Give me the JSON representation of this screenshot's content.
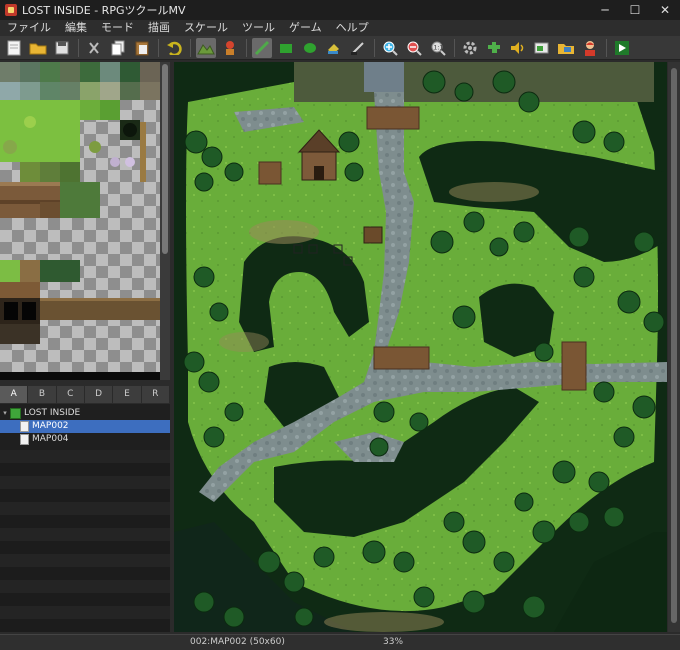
{
  "window": {
    "title": "LOST INSIDE - RPGツクールMV",
    "minimize": "─",
    "maximize": "☐",
    "close": "✕"
  },
  "menu": [
    "ファイル",
    "編集",
    "モード",
    "描画",
    "スケール",
    "ツール",
    "ゲーム",
    "ヘルプ"
  ],
  "toolbar": [
    "new-project",
    "open-project",
    "save-project",
    "cut",
    "copy",
    "paste",
    "undo",
    "map-mode",
    "event-mode",
    "pencil",
    "rectangle",
    "ellipse",
    "fill",
    "shadow-pen",
    "zoom-in",
    "zoom-out",
    "actual-size",
    "database",
    "plugin-manager",
    "sound-test",
    "event-searcher",
    "resource-manager",
    "character-generator",
    "playtest"
  ],
  "tileset_tabs": [
    "A",
    "B",
    "C",
    "D",
    "E",
    "R"
  ],
  "map_tree": {
    "root": "LOST INSIDE",
    "items": [
      "MAP002",
      "MAP004"
    ],
    "selected": "MAP002"
  },
  "status": {
    "map": "002:MAP002 (50x60)",
    "zoom": "33%"
  },
  "colors": {
    "accent": "#3d6ebf",
    "grass": "#6cae3a",
    "forest": "#0f2a14",
    "path": "#7d8a8c",
    "water": "#5b7d8a"
  }
}
